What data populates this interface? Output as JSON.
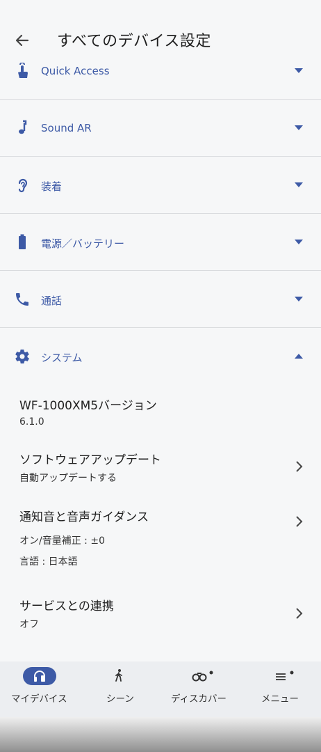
{
  "header": {
    "title": "すべてのデバイス設定"
  },
  "sections": {
    "quick_access": {
      "label": "Quick Access",
      "icon": "touch-hand-icon"
    },
    "sound_ar": {
      "label": "Sound AR",
      "icon": "music-note-icon"
    },
    "wearing": {
      "label": "装着",
      "icon": "ear-icon"
    },
    "power": {
      "label": "電源／バッテリー",
      "icon": "battery-icon"
    },
    "call": {
      "label": "通話",
      "icon": "phone-icon"
    },
    "system": {
      "label": "システム",
      "icon": "gear-icon",
      "expanded": true
    }
  },
  "system_items": {
    "version": {
      "title": "WF-1000XM5バージョン",
      "value": "6.1.0"
    },
    "software_update": {
      "title": "ソフトウェアアップデート",
      "value": "自動アップデートする"
    },
    "notification_sound": {
      "title": "通知音と音声ガイダンス",
      "value1": "オン/音量補正 : ±0",
      "value2": "言語 : 日本語"
    },
    "service_link": {
      "title": "サービスとの連携",
      "value": "オフ"
    }
  },
  "bottom_nav": {
    "my_device": "マイデバイス",
    "scene": "シーン",
    "discover": "ディスカバー",
    "menu": "メニュー"
  },
  "colors": {
    "accent": "#3d5aa6",
    "background": "#f6f7f8",
    "divider": "#d9dbde",
    "nav_bg": "#eceef1"
  }
}
